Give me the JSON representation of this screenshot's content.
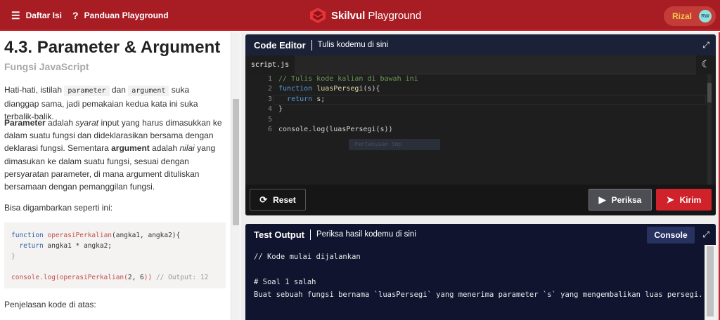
{
  "topbar": {
    "menu_label": "Daftar Isi",
    "guide_label": "Panduan Playground",
    "brand_bold": "Skilvul",
    "brand_rest": "Playground",
    "user_name": "Rizal",
    "user_initials": "RW",
    "accent": "#a81d24"
  },
  "lesson": {
    "title": "4.3. Parameter & Argument",
    "subtitle": "Fungsi JavaScript",
    "p1_a": "Hati-hati, istilah ",
    "p1_code1": "parameter",
    "p1_b": " dan ",
    "p1_code2": "argument",
    "p1_c": " suka dianggap sama, jadi pemakaian kedua kata ini suka terbalik-balik.",
    "p2_b1": "Parameter",
    "p2_t1": " adalah ",
    "p2_i1": "syarat",
    "p2_t2": " input yang harus dimasukkan ke dalam suatu fungsi dan dideklarasikan bersama dengan deklarasi fungsi. Sementara ",
    "p2_b2": "argument",
    "p2_t3": " adalah ",
    "p2_i2": "nilai",
    "p2_t4": " yang dimasukan ke dalam suatu fungsi, sesuai dengan persyaratan parameter, di mana argument dituliskan bersamaan dengan pemanggilan fungsi.",
    "p3": "Bisa digambarkan seperti ini:",
    "code": {
      "l1_kw": "function",
      "l1_fn": "operasiPerkalian",
      "l1_rest": "(angka1, angka2){",
      "l2_kw": "return",
      "l2_rest": " angka1 * angka2;",
      "l3": "}",
      "l5_fn": "console.log(operasiPerkalian(",
      "l5_num": "2, 6",
      "l5_end": ")) ",
      "l5_comment": "// Output: 12"
    },
    "p4": "Penjelasan kode di atas:"
  },
  "editor": {
    "title": "Code Editor",
    "subtitle": "Tulis kodemu di sini",
    "tab": "script.js",
    "line_numbers": [
      "1",
      "2",
      "3",
      "4",
      "5",
      "6"
    ],
    "lines": {
      "l1": "// Tulis kode kalian di bawah ini",
      "l2_kw": "function",
      "l2_fn": "luasPersegi",
      "l2_rest": "(s){",
      "l3_kw": "return",
      "l3_rest": " s;",
      "l4": "}",
      "l6": "console.log(luasPersegi(s))"
    },
    "hint": "Pertanyaan tmp",
    "reset_label": "Reset",
    "check_label": "Periksa",
    "submit_label": "Kirim"
  },
  "output": {
    "title": "Test Output",
    "subtitle": "Periksa hasil kodemu di sini",
    "console_label": "Console",
    "text": "// Kode mulai dijalankan\n\n# Soal 1 salah\nBuat sebuah fungsi bernama `luasPersegi` yang menerima parameter `s` yang mengembalikan luas persegi."
  },
  "icons": {
    "menu": "menu-icon",
    "help": "help-icon",
    "expand": "expand-icon",
    "moon": "moon-icon",
    "reset": "reset-icon",
    "play": "play-icon",
    "send": "send-icon"
  }
}
